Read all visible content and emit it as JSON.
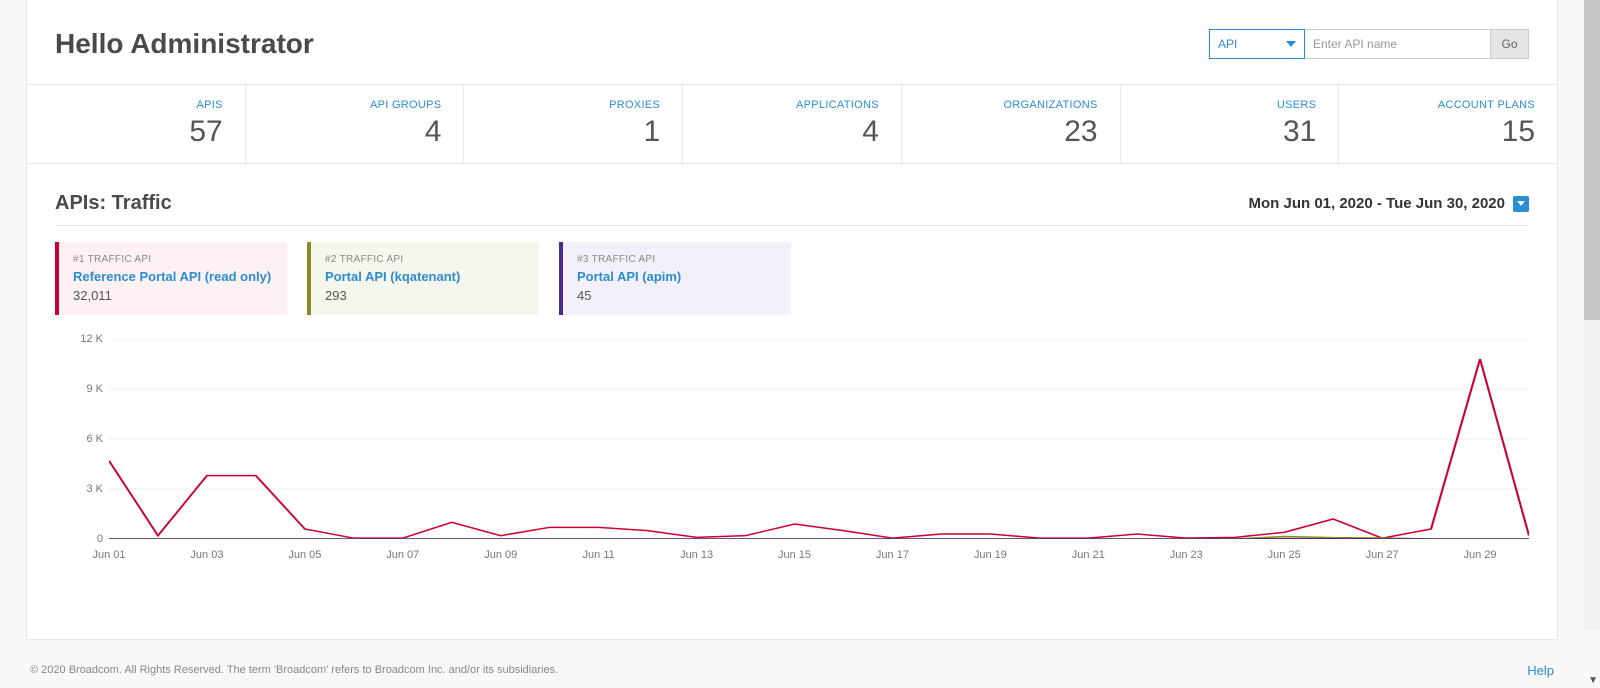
{
  "header": {
    "title": "Hello Administrator",
    "type_selected": "API",
    "search_placeholder": "Enter API name",
    "go_label": "Go"
  },
  "stats": [
    {
      "label": "APIS",
      "value": "57"
    },
    {
      "label": "API GROUPS",
      "value": "4"
    },
    {
      "label": "PROXIES",
      "value": "1"
    },
    {
      "label": "APPLICATIONS",
      "value": "4"
    },
    {
      "label": "ORGANIZATIONS",
      "value": "23"
    },
    {
      "label": "USERS",
      "value": "31"
    },
    {
      "label": "ACCOUNT PLANS",
      "value": "15"
    }
  ],
  "traffic": {
    "section_title": "APIs: Traffic",
    "date_range": "Mon Jun 01, 2020 - Tue Jun 30, 2020",
    "cards": [
      {
        "rank": "#1 TRAFFIC API",
        "name": "Reference Portal API (read only)",
        "value": "32,011"
      },
      {
        "rank": "#2 TRAFFIC API",
        "name": "Portal API (kqatenant)",
        "value": "293"
      },
      {
        "rank": "#3 TRAFFIC API",
        "name": "Portal API (apim)",
        "value": "45"
      }
    ]
  },
  "chart_data": {
    "type": "line",
    "xlabel": "",
    "ylabel": "",
    "ylim": [
      0,
      12000
    ],
    "y_ticks": [
      0,
      3000,
      6000,
      9000,
      12000
    ],
    "y_tick_labels": [
      "0",
      "3 K",
      "6 K",
      "9 K",
      "12 K"
    ],
    "categories": [
      "Jun 01",
      "Jun 02",
      "Jun 03",
      "Jun 04",
      "Jun 05",
      "Jun 06",
      "Jun 07",
      "Jun 08",
      "Jun 09",
      "Jun 10",
      "Jun 11",
      "Jun 12",
      "Jun 13",
      "Jun 14",
      "Jun 15",
      "Jun 16",
      "Jun 17",
      "Jun 18",
      "Jun 19",
      "Jun 20",
      "Jun 21",
      "Jun 22",
      "Jun 23",
      "Jun 24",
      "Jun 25",
      "Jun 26",
      "Jun 27",
      "Jun 28",
      "Jun 29",
      "Jun 30"
    ],
    "x_tick_labels": [
      "Jun 01",
      "Jun 03",
      "Jun 05",
      "Jun 07",
      "Jun 09",
      "Jun 11",
      "Jun 13",
      "Jun 15",
      "Jun 17",
      "Jun 19",
      "Jun 21",
      "Jun 23",
      "Jun 25",
      "Jun 27",
      "Jun 29"
    ],
    "series": [
      {
        "name": "Reference Portal API (read only)",
        "color": "#cc0033",
        "values": [
          4700,
          200,
          3800,
          3800,
          600,
          50,
          50,
          1000,
          200,
          700,
          700,
          500,
          100,
          200,
          900,
          500,
          50,
          300,
          300,
          50,
          50,
          300,
          50,
          100,
          400,
          1200,
          50,
          600,
          10800,
          200
        ]
      },
      {
        "name": "Portal API (kqatenant)",
        "color": "#8c8a1f",
        "values": [
          0,
          0,
          0,
          0,
          0,
          0,
          0,
          0,
          0,
          0,
          0,
          0,
          0,
          0,
          0,
          0,
          0,
          0,
          0,
          0,
          0,
          0,
          0,
          0,
          150,
          80,
          60,
          0,
          0,
          0
        ]
      },
      {
        "name": "Portal API (apim)",
        "color": "#4b2a8f",
        "values": [
          0,
          0,
          0,
          0,
          0,
          0,
          0,
          0,
          0,
          0,
          0,
          0,
          0,
          0,
          0,
          0,
          0,
          0,
          0,
          0,
          0,
          0,
          0,
          0,
          20,
          15,
          10,
          0,
          0,
          0
        ]
      }
    ]
  },
  "footer": {
    "copyright": "© 2020 Broadcom. All Rights Reserved. The term 'Broadcom' refers to Broadcom Inc. and/or its subsidiaries.",
    "help": "Help"
  }
}
